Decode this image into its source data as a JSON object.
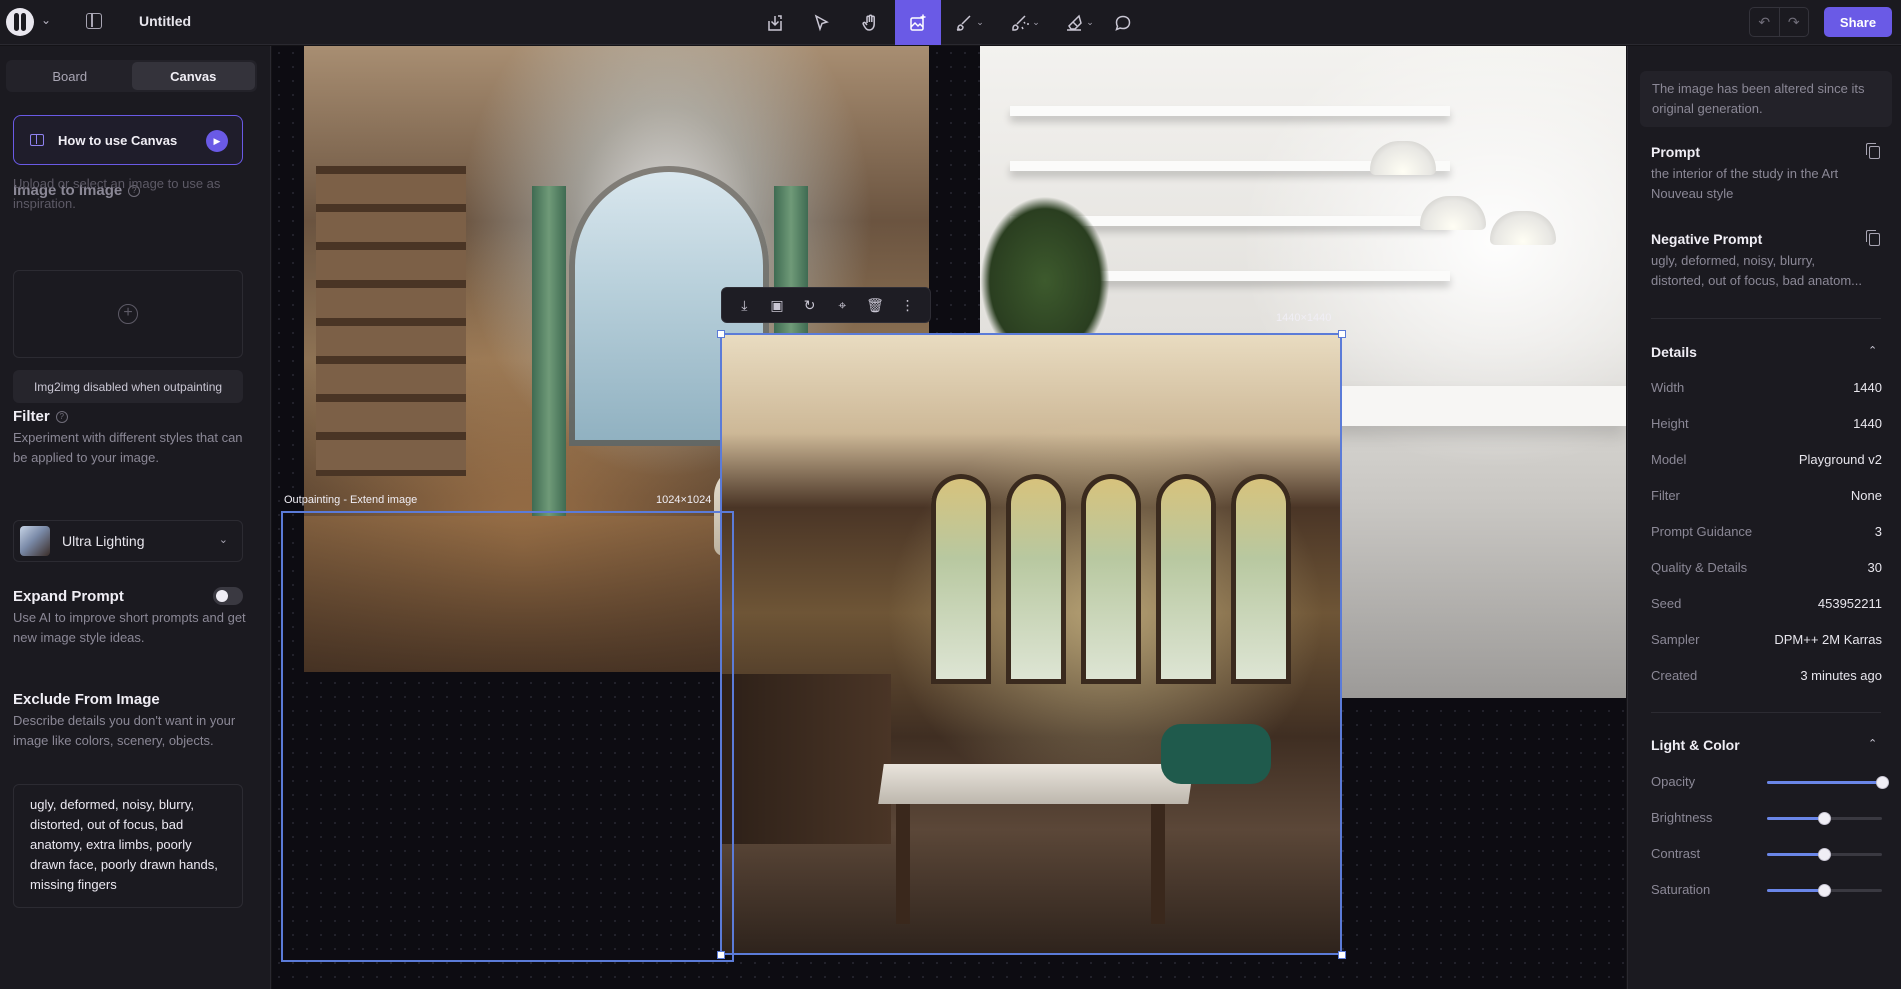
{
  "topbar": {
    "title": "Untitled",
    "share_label": "Share",
    "tools": [
      {
        "name": "import-image-tool",
        "icon": "import-icon"
      },
      {
        "name": "select-tool",
        "icon": "pointer-icon"
      },
      {
        "name": "hand-tool",
        "icon": "hand-icon"
      },
      {
        "name": "generate-image-tool",
        "icon": "image-plus-icon",
        "active": true
      },
      {
        "name": "brush-tool",
        "icon": "brush-icon"
      },
      {
        "name": "inpaint-tool",
        "icon": "magic-brush-icon"
      },
      {
        "name": "eraser-tool",
        "icon": "eraser-icon"
      },
      {
        "name": "comment-tool",
        "icon": "comment-icon"
      }
    ],
    "accent_color": "#6a5ae6"
  },
  "left_panel": {
    "tabs": [
      "Board",
      "Canvas"
    ],
    "active_tab": "Canvas",
    "how_to_label": "How to use Canvas",
    "img2img": {
      "title": "Image to Image",
      "description": "Upload or select an image to use as inspiration.",
      "disabled_note": "Img2img disabled when outpainting"
    },
    "filter": {
      "title": "Filter",
      "description": "Experiment with different styles that can be applied to your image.",
      "selected": "Ultra Lighting"
    },
    "expand_prompt": {
      "title": "Expand Prompt",
      "description": "Use AI to improve short prompts and get new image style ideas.",
      "enabled": false
    },
    "exclude": {
      "title": "Exclude From Image",
      "description": "Describe details you don't want in your image like colors, scenery, objects.",
      "value": "ugly, deformed, noisy, blurry, distorted, out of focus, bad anatomy, extra limbs, poorly drawn face, poorly drawn hands, missing fingers"
    }
  },
  "canvas": {
    "outpaint_label": "Outpainting - Extend image",
    "outpaint_size": "1024×1024",
    "selection_size": "1440×1440",
    "selection_color": "#5b7bd8"
  },
  "right_panel": {
    "notice": "The image has been altered since its original generation.",
    "prompt_title": "Prompt",
    "prompt_text": "the interior of the study in the Art Nouveau style",
    "negative_title": "Negative Prompt",
    "negative_text": "ugly, deformed, noisy, blurry, distorted, out of focus, bad anatom...",
    "details_title": "Details",
    "details": [
      {
        "k": "Width",
        "v": "1440"
      },
      {
        "k": "Height",
        "v": "1440"
      },
      {
        "k": "Model",
        "v": "Playground v2"
      },
      {
        "k": "Filter",
        "v": "None"
      },
      {
        "k": "Prompt Guidance",
        "v": "3"
      },
      {
        "k": "Quality & Details",
        "v": "30"
      },
      {
        "k": "Seed",
        "v": "453952211"
      },
      {
        "k": "Sampler",
        "v": "DPM++ 2M Karras"
      },
      {
        "k": "Created",
        "v": "3 minutes ago"
      }
    ],
    "light_title": "Light & Color",
    "sliders": [
      {
        "k": "Opacity",
        "value": 1.0
      },
      {
        "k": "Brightness",
        "value": 0.5
      },
      {
        "k": "Contrast",
        "value": 0.5
      },
      {
        "k": "Saturation",
        "value": 0.5
      }
    ]
  }
}
